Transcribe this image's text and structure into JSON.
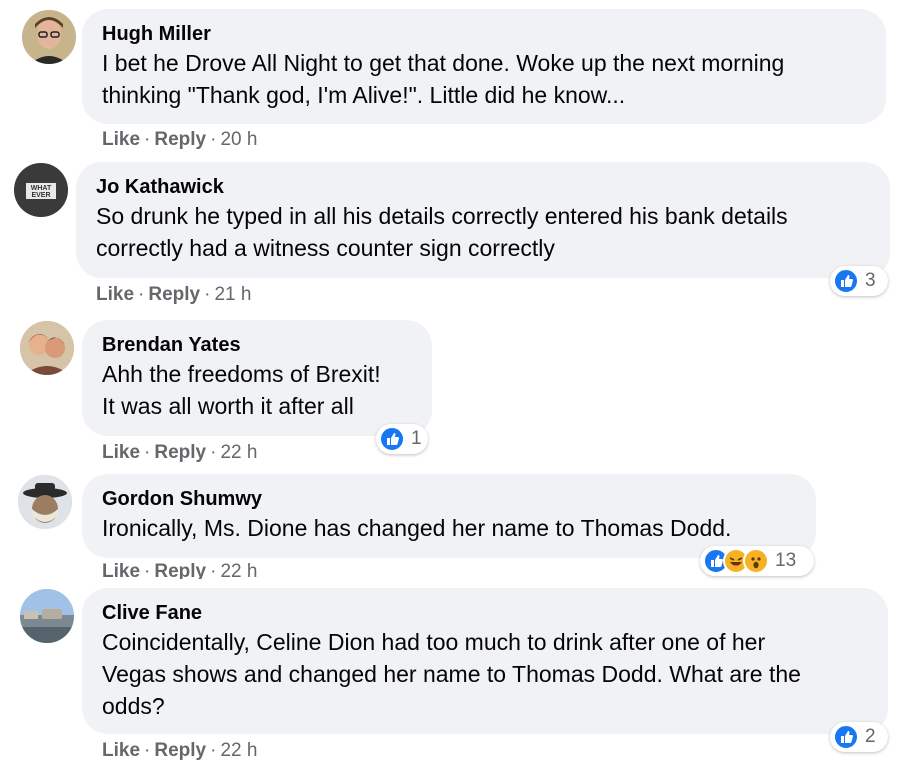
{
  "comments": [
    {
      "author": "Hugh Miller",
      "lines": [
        "I bet he Drove All Night to get that done. Woke up the next morning",
        "thinking \"Thank god, I'm Alive!\". Little did he know..."
      ],
      "like": "Like",
      "reply": "Reply",
      "time": "20 h",
      "reaction_count": null
    },
    {
      "author": "Jo Kathawick",
      "lines": [
        "So drunk he typed in all his details correctly entered his bank details",
        "correctly had a witness counter sign correctly"
      ],
      "like": "Like",
      "reply": "Reply",
      "time": "21 h",
      "reaction_count": "3"
    },
    {
      "author": "Brendan Yates",
      "lines": [
        "Ahh the freedoms of Brexit!",
        "It was all worth it after all"
      ],
      "like": "Like",
      "reply": "Reply",
      "time": "22 h",
      "reaction_count": "1"
    },
    {
      "author": "Gordon Shumwy",
      "lines": [
        "Ironically, Ms. Dione has changed her name to Thomas Dodd."
      ],
      "like": "Like",
      "reply": "Reply",
      "time": "22 h",
      "reaction_count": "13"
    },
    {
      "author": "Clive Fane",
      "lines": [
        "Coincidentally, Celine Dion had too much to drink after one of her",
        "Vegas shows and changed her name to Thomas Dodd. What are the",
        "odds?"
      ],
      "like": "Like",
      "reply": "Reply",
      "time": "22 h",
      "reaction_count": "2"
    }
  ],
  "separator": "·",
  "avatar_badge_text": [
    "WHAT",
    "EVER"
  ],
  "colors": {
    "bubble": "#f0f2f5",
    "like_blue": "#1877f2",
    "meta_gray": "#65676b",
    "emoji_yellow": "#f7b125"
  },
  "icons": {
    "like_reaction": "thumbs-up-icon",
    "haha_reaction": "laughing-face-icon",
    "wow_reaction": "wow-face-icon"
  }
}
